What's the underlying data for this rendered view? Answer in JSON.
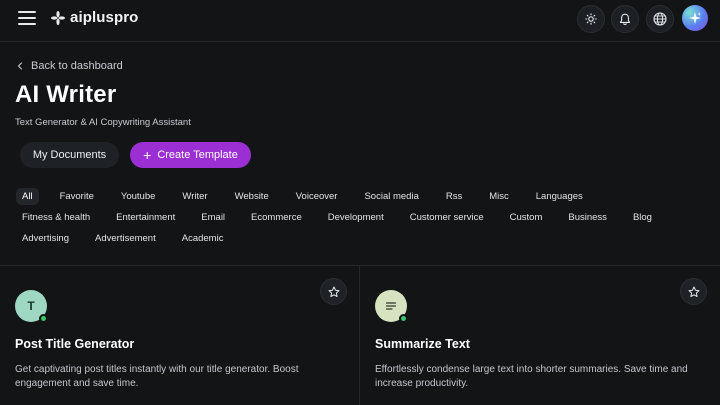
{
  "header": {
    "brand": "aipluspro",
    "icons": [
      "menu-icon",
      "sun-icon",
      "bell-icon",
      "globe-icon",
      "sparkle-icon"
    ]
  },
  "page": {
    "back_label": "Back to dashboard",
    "title": "AI Writer",
    "subtitle": "Text Generator & AI Copywriting Assistant"
  },
  "actions": {
    "my_documents": "My Documents",
    "create_template": "Create Template"
  },
  "filters": {
    "active": "All",
    "rows": [
      [
        "All",
        "Favorite",
        "Youtube",
        "Writer",
        "Website",
        "Voiceover",
        "Social media",
        "Rss",
        "Misc",
        "Languages"
      ],
      [
        "Fitness & health",
        "Entertainment",
        "Email",
        "Ecommerce",
        "Development",
        "Customer service",
        "Custom",
        "Business",
        "Blog"
      ],
      [
        "Advertising",
        "Advertisement",
        "Academic"
      ]
    ]
  },
  "cards": [
    {
      "icon_letter": "T",
      "icon_bg": "#9fd8c2",
      "title": "Post Title Generator",
      "description": "Get captivating post titles instantly with our title generator. Boost engagement and save time."
    },
    {
      "icon_name": "lines-icon",
      "icon_bg": "#d6e2c0",
      "title": "Summarize Text",
      "description": "Effortlessly condense large text into shorter summaries. Save time and increase productivity."
    }
  ],
  "colors": {
    "background": "#121416",
    "accent": "#9b2fd4",
    "status_online": "#3ac66a"
  }
}
